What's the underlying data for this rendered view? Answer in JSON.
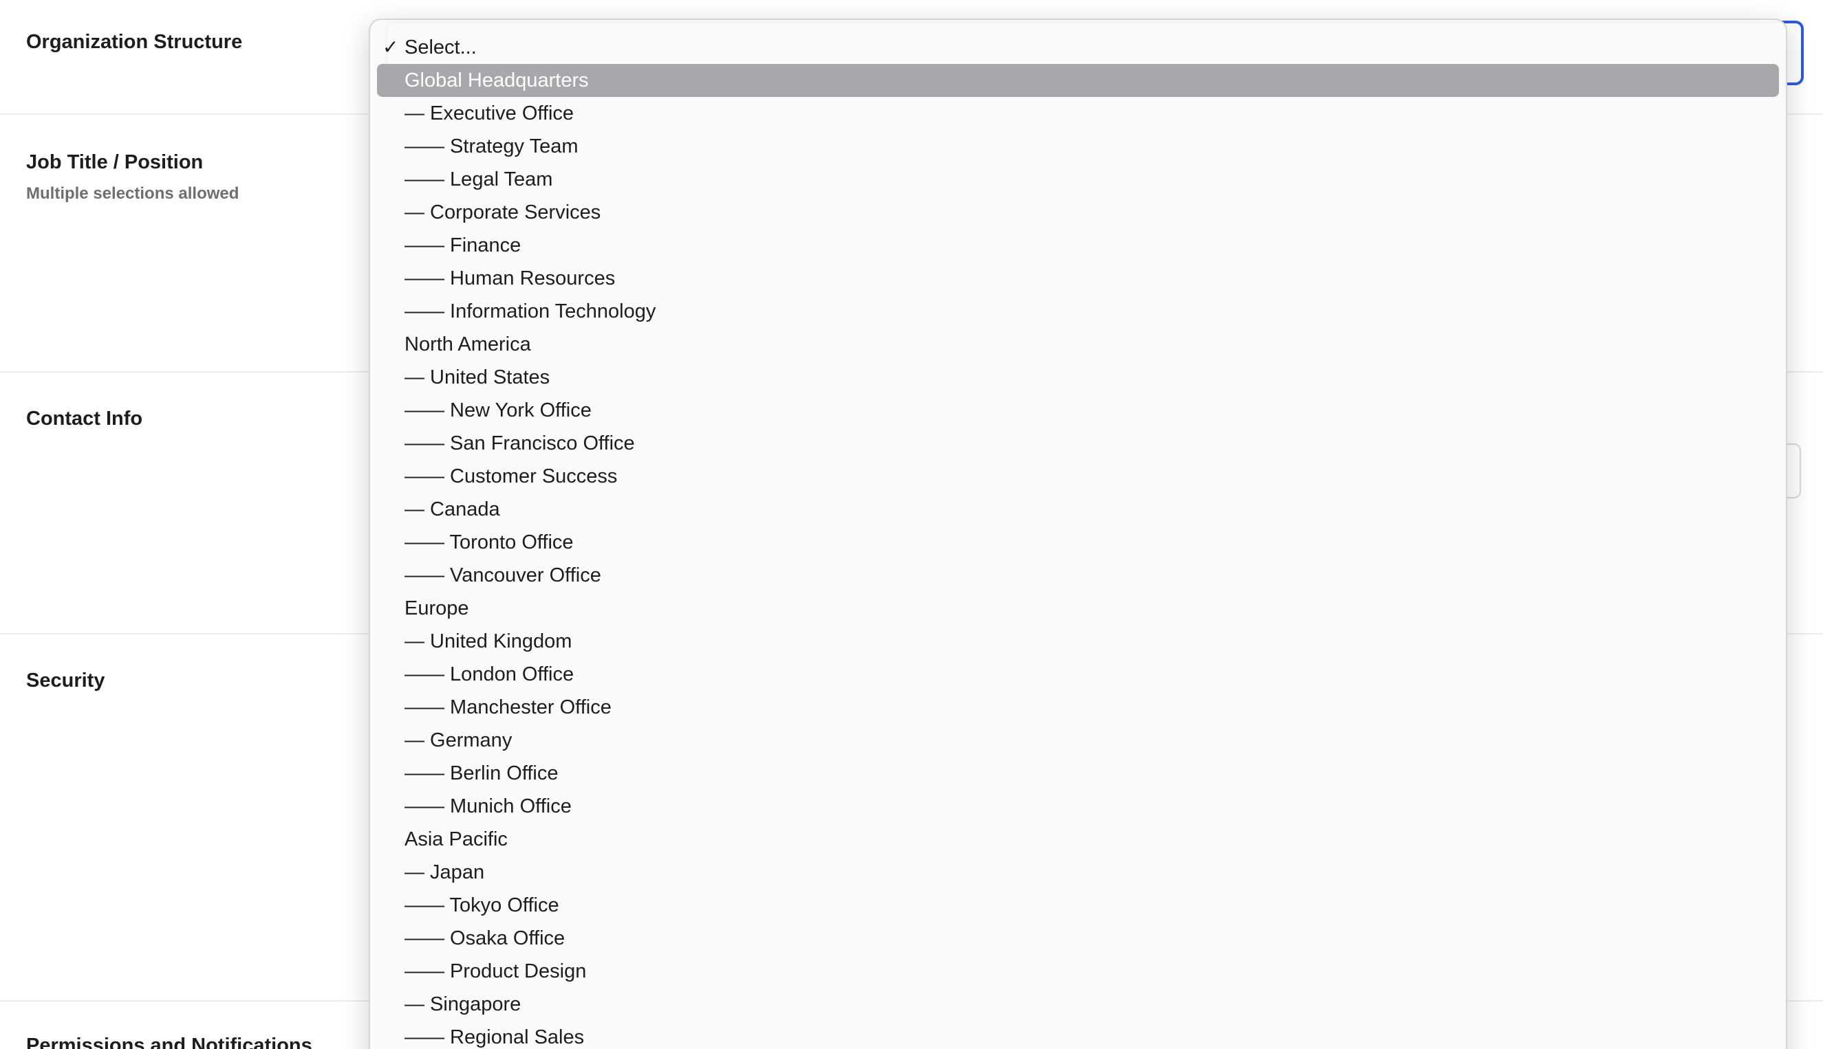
{
  "sections": [
    {
      "label": "Organization Structure",
      "sub": ""
    },
    {
      "label": "Job Title / Position",
      "sub": "Multiple selections allowed"
    },
    {
      "label": "Contact Info",
      "sub": ""
    },
    {
      "label": "Security",
      "sub": ""
    },
    {
      "label": "Permissions and Notifications",
      "sub": ""
    }
  ],
  "dropdown": {
    "selected_index": 0,
    "highlighted_index": 1,
    "options": [
      {
        "label": "Select...",
        "checked": true
      },
      {
        "label": "Global Headquarters"
      },
      {
        "label": "— Executive Office"
      },
      {
        "label": "—— Strategy Team"
      },
      {
        "label": "—— Legal Team"
      },
      {
        "label": "— Corporate Services"
      },
      {
        "label": "—— Finance"
      },
      {
        "label": "—— Human Resources"
      },
      {
        "label": "—— Information Technology"
      },
      {
        "label": "North America"
      },
      {
        "label": "— United States"
      },
      {
        "label": "—— New York Office"
      },
      {
        "label": "—— San Francisco Office"
      },
      {
        "label": "—— Customer Success"
      },
      {
        "label": "— Canada"
      },
      {
        "label": "—— Toronto Office"
      },
      {
        "label": "—— Vancouver Office"
      },
      {
        "label": "Europe"
      },
      {
        "label": "— United Kingdom"
      },
      {
        "label": "—— London Office"
      },
      {
        "label": "—— Manchester Office"
      },
      {
        "label": "— Germany"
      },
      {
        "label": "—— Berlin Office"
      },
      {
        "label": "—— Munich Office"
      },
      {
        "label": "Asia Pacific"
      },
      {
        "label": "— Japan"
      },
      {
        "label": "—— Tokyo Office"
      },
      {
        "label": "—— Osaka Office"
      },
      {
        "label": "—— Product Design"
      },
      {
        "label": "— Singapore"
      },
      {
        "label": "—— Regional Sales"
      }
    ],
    "check_glyph": "✓"
  },
  "colors": {
    "highlight": "#a7a8ac",
    "focus_border": "#2f5bd6"
  }
}
